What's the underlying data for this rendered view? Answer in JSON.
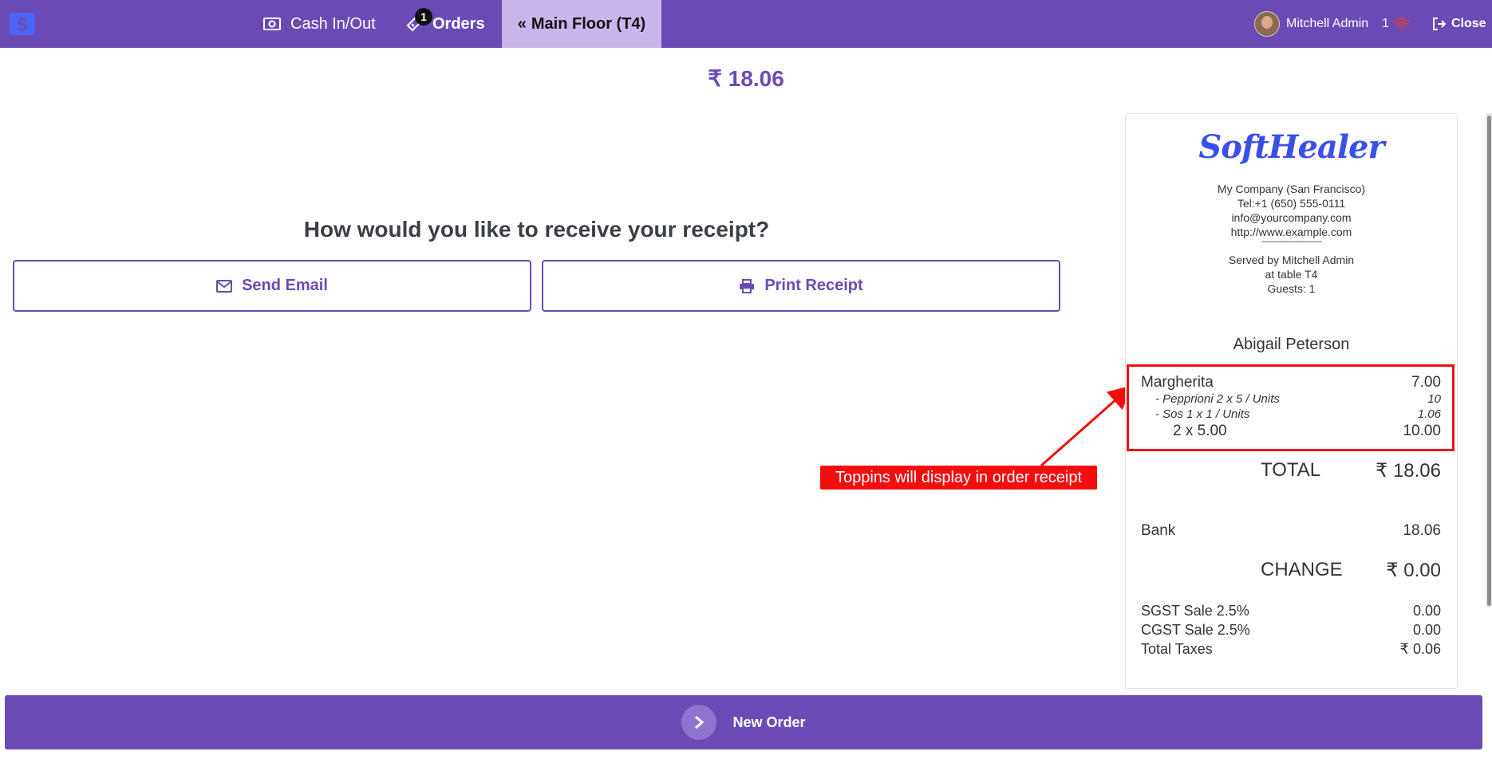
{
  "header": {
    "cash_label": "Cash In/Out",
    "orders_label": "Orders",
    "orders_badge": "1",
    "floor_label": "Main Floor (T4)",
    "user_name": "Mitchell Admin",
    "sync_count": "1",
    "close_label": "Close"
  },
  "payment": {
    "amount": "₹ 18.06",
    "question": "How would you like to receive your receipt?",
    "send_email": "Send Email",
    "print_receipt": "Print Receipt"
  },
  "annotation": "Toppins will display in order receipt",
  "receipt": {
    "brand": "SoftHealer",
    "company": "My Company (San Francisco)",
    "tel": "Tel:+1 (650) 555-0111",
    "email": "info@yourcompany.com",
    "website": "http://www.example.com",
    "separator": "--------------------------------",
    "served_by": "Served by Mitchell Admin",
    "table": "at table T4",
    "guests": "Guests: 1",
    "customer": "Abigail Peterson",
    "line": {
      "product": "Margherita",
      "price": "7.00",
      "topping1_name": "- Pepprioni 2 x 5 / Units",
      "topping1_price": "10",
      "topping2_name": "- Sos 1 x 1 / Units",
      "topping2_price": "1.06",
      "qty_label": "2 x 5.00",
      "qty_total": "10.00"
    },
    "total_label": "TOTAL",
    "total_value": "₹ 18.06",
    "payment_method": "Bank",
    "payment_value": "18.06",
    "change_label": "CHANGE",
    "change_value": "₹ 0.00",
    "sgst_label": "SGST Sale 2.5%",
    "sgst_value": "0.00",
    "cgst_label": "CGST Sale 2.5%",
    "cgst_value": "0.00",
    "taxes_label": "Total Taxes",
    "taxes_value": "₹ 0.06"
  },
  "footer": {
    "new_order": "New Order"
  },
  "colors": {
    "primary": "#6a4bb5",
    "highlight": "#c8b6ea",
    "annotation_red": "#f20e0e",
    "brand_blue": "#3a4fe8"
  }
}
